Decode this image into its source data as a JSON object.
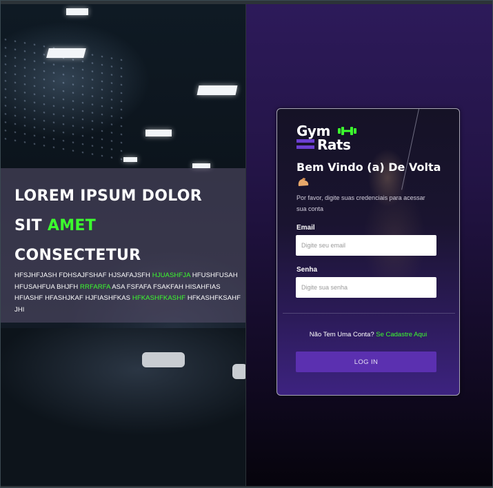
{
  "hero": {
    "line1": "LOREM IPSUM DOLOR",
    "line2_plain": "SIT ",
    "line2_accent": "AMET",
    "line3": "CONSECTETUR",
    "body": [
      {
        "text": "HFSJHFJASH FDHSAJFSHAF HJSAFAJSFH ",
        "accent": false
      },
      {
        "text": "HJUASHFJA",
        "accent": true
      },
      {
        "text": " HFUSHFUSAH HFUSAHFUA BHJFH ",
        "accent": false
      },
      {
        "text": "RRFARFA",
        "accent": true
      },
      {
        "text": " ASA FSFAFA FSAKFAH HISAHFIAS HFIASHF HFASHJKAF HJFIASHFKAS ",
        "accent": false
      },
      {
        "text": "HFKASHFKASHF",
        "accent": true
      },
      {
        "text": " HFKASHFKSAHF JHI",
        "accent": false
      }
    ]
  },
  "logo": {
    "word1": "Gym",
    "word2": "Rats",
    "icon": "dumbbell-icon"
  },
  "login": {
    "title": "Bem Vindo (a) De Volta",
    "title_icon": "flexed-biceps-icon",
    "subtitle": "Por favor, digite suas credenciais para acessar sua conta",
    "email_label": "Email",
    "email_placeholder": "Digite seu email",
    "email_value": "",
    "password_label": "Senha",
    "password_placeholder": "Digite sua senha",
    "password_value": "",
    "signup_prompt": "Não Tem Uma Conta?",
    "signup_link": "Se Cadastre Aqui",
    "login_button": "LOG IN"
  },
  "colors": {
    "accent_green": "#3cff2e",
    "brand_purple": "#5b30b0",
    "panel_purple": "#2d1a5a"
  }
}
